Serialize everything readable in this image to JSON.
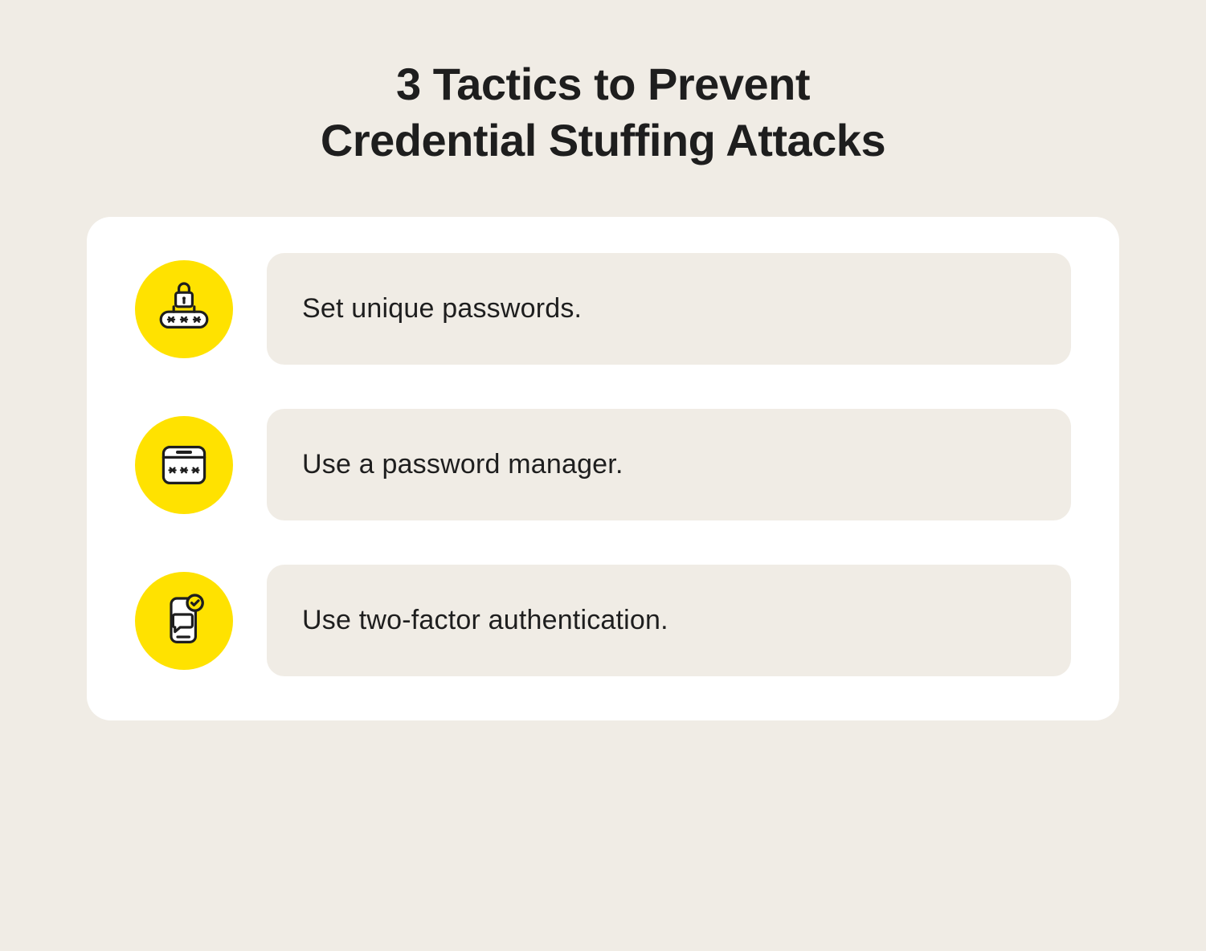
{
  "title": "3 Tactics to Prevent\nCredential Stuffing Attacks",
  "colors": {
    "page_bg": "#f0ece5",
    "card_bg": "#ffffff",
    "pill_bg": "#f0ece5",
    "icon_bg": "#ffe200",
    "text": "#1e1e1e",
    "icon_stroke": "#1e1e1e",
    "icon_fill": "#ffffff"
  },
  "tactics": [
    {
      "icon": "password-lock-icon",
      "text": "Set unique passwords."
    },
    {
      "icon": "password-manager-icon",
      "text": "Use a password manager."
    },
    {
      "icon": "two-factor-icon",
      "text": "Use two-factor authentication."
    }
  ]
}
